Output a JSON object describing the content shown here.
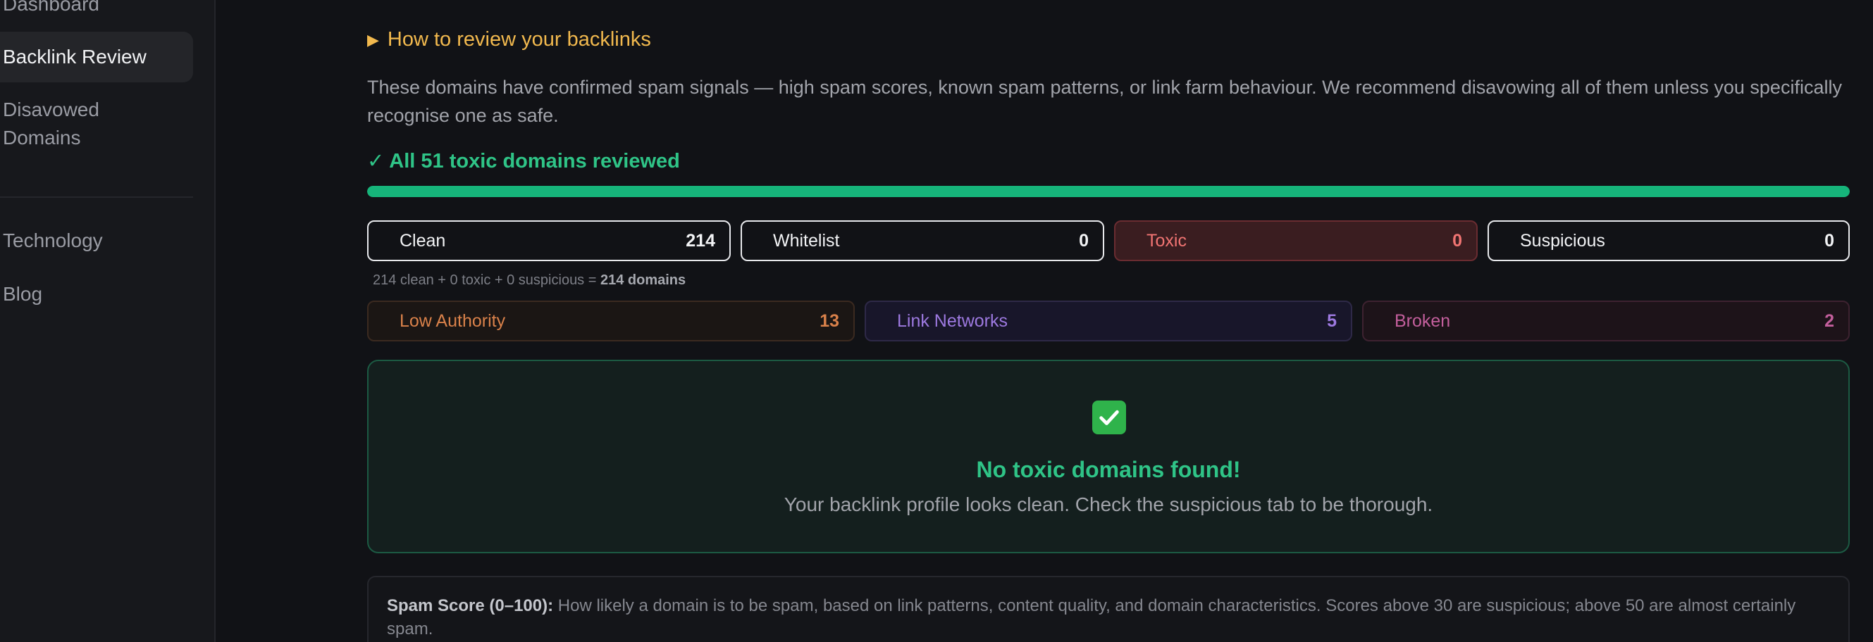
{
  "sidebar": {
    "items": [
      {
        "label": "Dashboard",
        "active": false
      },
      {
        "label": "Backlink Review",
        "active": true
      },
      {
        "label": "Disavowed Domains",
        "active": false
      },
      {
        "label": "Technology",
        "active": false
      },
      {
        "label": "Blog",
        "active": false
      }
    ]
  },
  "howto": {
    "label": "How to review your backlinks"
  },
  "description": "These domains have confirmed spam signals — high spam scores, known spam patterns, or link farm behaviour. We recommend disavowing all of them unless you specifically recognise one as safe.",
  "review_status": "✓ All 51 toxic domains reviewed",
  "progress_fraction": 1.0,
  "stats": [
    {
      "label": "Clean",
      "count": "214"
    },
    {
      "label": "Whitelist",
      "count": "0"
    },
    {
      "label": "Toxic",
      "count": "0"
    },
    {
      "label": "Suspicious",
      "count": "0"
    }
  ],
  "summary": {
    "text": "214 clean + 0 toxic + 0 suspicious = ",
    "total": "214 domains"
  },
  "categories": [
    {
      "label": "Low Authority",
      "count": "13"
    },
    {
      "label": "Link Networks",
      "count": "5"
    },
    {
      "label": "Broken",
      "count": "2"
    }
  ],
  "empty_state": {
    "icon": "check-mark-button-icon",
    "title": "No toxic domains found!",
    "subtitle": "Your backlink profile looks clean. Check the suspicious tab to be thorough."
  },
  "info": {
    "term": "Spam Score (0–100):",
    "text": "How likely a domain is to be spam, based on link patterns, content quality, and domain characteristics. Scores above 30 are suspicious; above 50 are almost certainly spam."
  },
  "colors": {
    "accent_green": "#2fc487",
    "accent_orange": "#f2b94e",
    "toxic_red": "#f07472"
  }
}
